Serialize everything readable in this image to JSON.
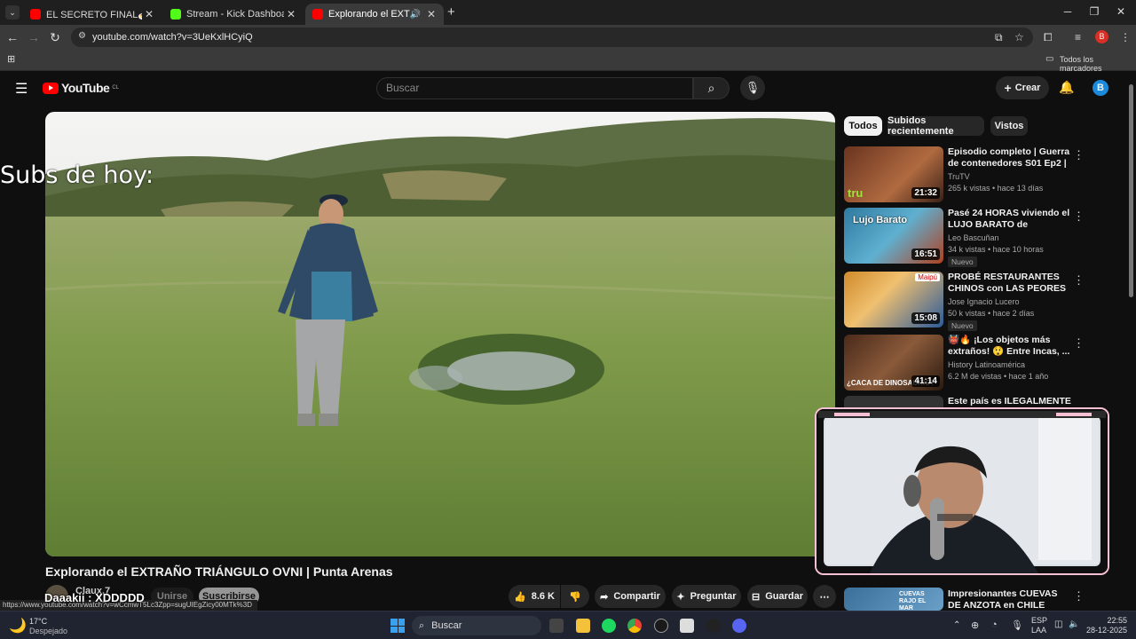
{
  "browser": {
    "tabs": [
      {
        "title": "EL SECRETO FINAL🍝 Capítulo",
        "active": false
      },
      {
        "title": "Stream - Kick Dashboard",
        "active": false
      },
      {
        "title": "Explorando el EXTRAÑO TRI",
        "active": true
      }
    ],
    "url": "youtube.com/watch?v=3UeKxlHCyiQ",
    "profile_initial": "B",
    "bookmarks_label": "Todos los marcadores"
  },
  "youtube": {
    "logo_text": "YouTube",
    "region": "CL",
    "search_placeholder": "Buscar",
    "create_label": "Crear",
    "account_initial": "B"
  },
  "video": {
    "overlay_text": "Subs de hoy:",
    "title": "Explorando el EXTRAÑO TRIÁNGULO OVNI | Punta Arenas",
    "channel": "Claux.7",
    "join_label": "Unirse",
    "subscribe_label": "Suscribirse",
    "likes": "8.6 K",
    "share_label": "Compartir",
    "ask_label": "Preguntar",
    "save_label": "Guardar"
  },
  "chips": [
    "Todos",
    "Subidos recientemente",
    "Vistos"
  ],
  "recommendations": [
    {
      "title": "Episodio completo | Guerra de contenedores S01 Ep2 | TruTV",
      "channel": "TruTV",
      "meta": "265 k vistas • hace 13 días",
      "duration": "21:32",
      "badge": "",
      "thumb_text": "tru",
      "thumb_color": "#8a4a2a"
    },
    {
      "title": "Pasé 24 HORAS viviendo el LUJO BARATO de VIETNAM",
      "channel": "Leo Bascuñan",
      "meta": "34 k vistas • hace 10 horas",
      "duration": "16:51",
      "badge": "Nuevo",
      "thumb_text": "Lujo Barato",
      "thumb_color": "#2d6f8f"
    },
    {
      "title": "PROBÉ RESTAURANTES CHINOS con LAS PEORES ...",
      "channel": "Jose Ignacio Lucero",
      "meta": "50 k vistas • hace 2 días",
      "duration": "15:08",
      "badge": "Nuevo",
      "thumb_text": "Maipú",
      "thumb_color": "#c57a2a"
    },
    {
      "title": "👹🔥 ¡Los objetos más extraños! 😲 Entre Incas, ...",
      "channel": "History Latinoamérica",
      "meta": "6.2 M de vistas • hace 1 año",
      "duration": "41:14",
      "badge": "",
      "thumb_text": "¿CACA DE DINOSAURIO?",
      "thumb_color": "#5a3a2a"
    },
    {
      "title": "Este país es ILEGALMENTE",
      "channel": "",
      "meta": "",
      "duration": "",
      "badge": "",
      "thumb_text": "",
      "thumb_color": "#333"
    },
    {
      "title": "Impresionantes CUEVAS DE ANZOTA en CHILE",
      "channel": "",
      "meta": "",
      "duration": "",
      "badge": "",
      "thumb_text": "CUEVAS RAJO EL MAR",
      "thumb_color": "#3a6f9a"
    }
  ],
  "stream_overlay": {
    "chat_user": "Daaakii",
    "chat_message": "XDDDDD",
    "status_url": "https://www.youtube.com/watch?v=wCcmwT5Lc3Zpp=sugUIEgZicy00MTk%3D"
  },
  "taskbar": {
    "weather_temp": "17°C",
    "weather_desc": "Despejado",
    "search_label": "Buscar",
    "lang_top": "ESP",
    "lang_bottom": "LAA",
    "time": "22:55",
    "date": "28-12-2025"
  },
  "colors": {
    "yt_red": "#ff0000",
    "bg": "#0f0f0f",
    "cam_border": "#f7c0d3"
  }
}
